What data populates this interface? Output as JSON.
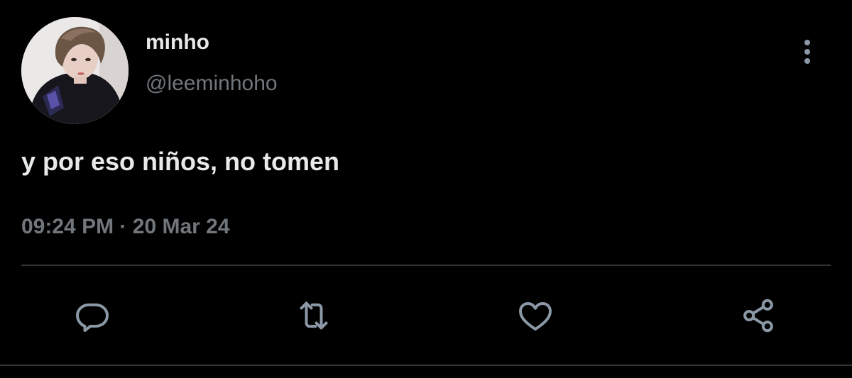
{
  "tweet": {
    "display_name": "minho",
    "handle": "@leeminhoho",
    "text": "y por eso niños, no tomen",
    "time": "09:24 PM",
    "separator": "·",
    "date": "20 Mar 24"
  },
  "actions": {
    "icons": [
      "reply-icon",
      "retweet-icon",
      "like-icon",
      "share-icon"
    ]
  },
  "colors": {
    "background": "#000000",
    "primary_text": "#e7e9ea",
    "secondary_text": "#71767b",
    "divider": "#2f3336",
    "icon": "#8b98a5"
  }
}
